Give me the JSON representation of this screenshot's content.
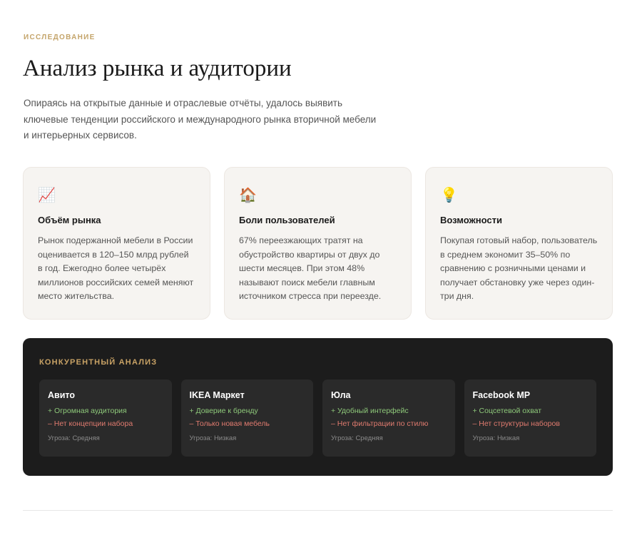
{
  "header": {
    "eyebrow": "ИССЛЕДОВАНИЕ",
    "title": "Анализ рынка и аудитории",
    "lead": "Опираясь на открытые данные и отраслевые отчёты, удалось выявить ключевые тенденции российского и международного рынка вторичной мебели и интерьерных сервисов."
  },
  "cards": [
    {
      "icon": "📈",
      "icon_name": "chart-increasing-icon",
      "title": "Объём рынка",
      "text": "Рынок подержанной мебели в России оценивается в 120–150 млрд рублей в год. Ежегодно более четырёх миллионов российских семей меняют место жительства."
    },
    {
      "icon": "🏠",
      "icon_name": "house-icon",
      "title": "Боли пользователей",
      "text": "67% переезжающих тратят на обустройство квартиры от двух до шести месяцев. При этом 48% называют поиск мебели главным источником стресса при переезде."
    },
    {
      "icon": "💡",
      "icon_name": "light-bulb-icon",
      "title": "Возможности",
      "text": "Покупая готовый набор, пользователь в среднем экономит 35–50% по сравнению с розничными ценами и получает обстановку уже через один-три дня."
    }
  ],
  "competitors": {
    "heading": "КОНКУРЕНТНЫЙ АНАЛИЗ",
    "items": [
      {
        "name": "Авито",
        "plus": "+ Огромная аудитория",
        "minus": "– Нет концепции набора",
        "threat": "Угроза: Средняя"
      },
      {
        "name": "IKEA Маркет",
        "plus": "+ Доверие к бренду",
        "minus": "– Только новая мебель",
        "threat": "Угроза: Низкая"
      },
      {
        "name": "Юла",
        "plus": "+ Удобный интерфейс",
        "minus": "– Нет фильтрации по стилю",
        "threat": "Угроза: Средняя"
      },
      {
        "name": "Facebook MP",
        "plus": "+ Соцсетевой охват",
        "minus": "– Нет структуры наборов",
        "threat": "Угроза: Низкая"
      }
    ]
  },
  "colors": {
    "accent": "#c4a46a",
    "positive": "#8ec97a",
    "negative": "#e07b6f",
    "dark_panel": "#1c1c1c"
  }
}
